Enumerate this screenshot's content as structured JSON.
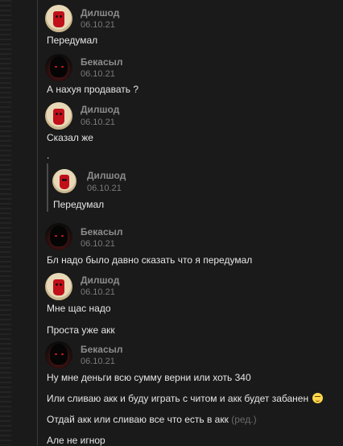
{
  "posts": [
    {
      "author": "Дилшод",
      "date": "06.10.21",
      "avatar": "dilshod-avatar",
      "messages": [
        "Передумал"
      ]
    },
    {
      "author": "Бекасыл",
      "date": "06.10.21",
      "avatar": "bekasyl-avatar",
      "messages": [
        "А нахуя продавать ?"
      ]
    },
    {
      "author": "Дилшод",
      "date": "06.10.21",
      "avatar": "dilshod-avatar",
      "messages": [
        "Сказал же",
        "."
      ],
      "quote": {
        "author": "Дилшод",
        "date": "06.10.21",
        "text": "Передумал"
      }
    },
    {
      "author": "Бекасыл",
      "date": "06.10.21",
      "avatar": "bekasyl-avatar",
      "messages": [
        "Бл надо было давно сказать что я передумал"
      ]
    },
    {
      "author": "Дилшод",
      "date": "06.10.21",
      "avatar": "dilshod-avatar",
      "messages": [
        "Мне щас надо",
        "Проста уже акк"
      ]
    },
    {
      "author": "Бекасыл",
      "date": "06.10.21",
      "avatar": "bekasyl-avatar",
      "messages": [
        "Ну мне деньги всю сумму верни или хоть 340",
        "Или сливаю акк и буду играть с читом и акк будет забанен",
        "Отдай акк или сливаю все что есть в акк",
        "Але не игнор"
      ],
      "edited_label": "(ред.)",
      "emoji_name": "smirk-emoji-icon"
    }
  ],
  "colors": {
    "background": "#1a1a1a",
    "text": "#e6e6e6",
    "author": "#8c8c8c",
    "date": "#7a7a7a"
  }
}
